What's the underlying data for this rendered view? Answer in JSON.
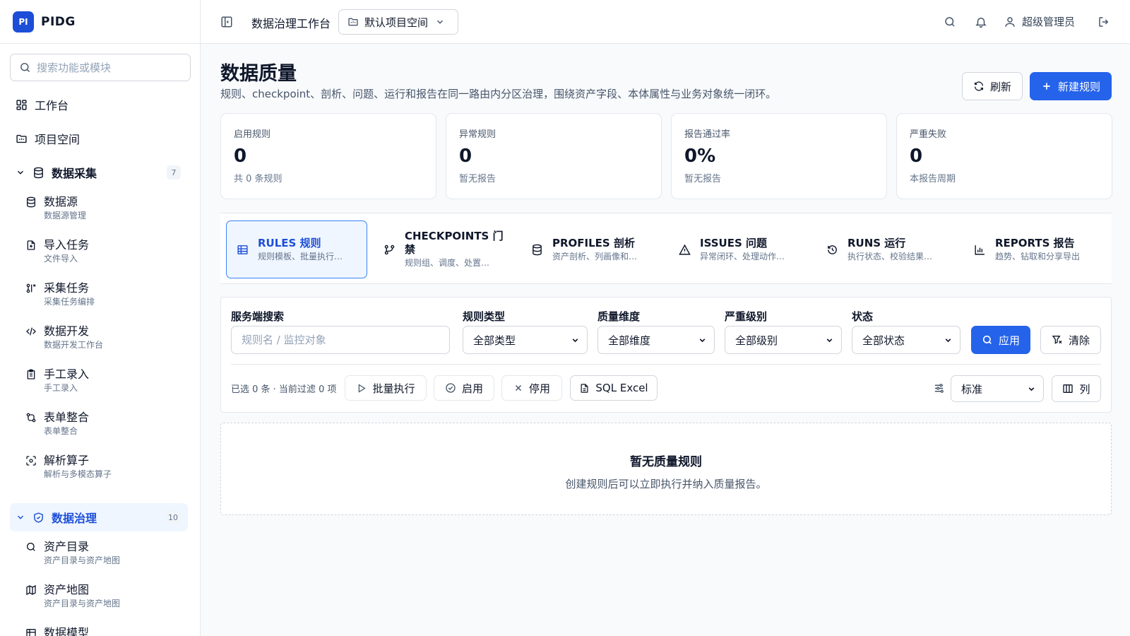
{
  "brand": {
    "logo": "PI",
    "name": "PIDG"
  },
  "sidebar": {
    "search_placeholder": "搜索功能或模块",
    "top_items": [
      {
        "label": "工作台",
        "icon": "dashboard-icon"
      },
      {
        "label": "项目空间",
        "icon": "folder-icon"
      }
    ],
    "group_collect": {
      "label": "数据采集",
      "badge": "7",
      "icon": "database-icon"
    },
    "collect_items": [
      {
        "label": "数据源",
        "sub": "数据源管理",
        "icon": "database-icon"
      },
      {
        "label": "导入任务",
        "sub": "文件导入",
        "icon": "file-import-icon"
      },
      {
        "label": "采集任务",
        "sub": "采集任务编排",
        "icon": "workflow-icon"
      },
      {
        "label": "数据开发",
        "sub": "数据开发工作台",
        "icon": "code-icon"
      },
      {
        "label": "手工录入",
        "sub": "手工录入",
        "icon": "clipboard-icon"
      },
      {
        "label": "表单整合",
        "sub": "表单整合",
        "icon": "merge-icon"
      },
      {
        "label": "解析算子",
        "sub": "解析与多模态算子",
        "icon": "scan-icon"
      }
    ],
    "group_govern": {
      "label": "数据治理",
      "badge": "10",
      "icon": "shield-icon"
    },
    "govern_items": [
      {
        "label": "资产目录",
        "sub": "资产目录与资产地图",
        "icon": "search-icon"
      },
      {
        "label": "资产地图",
        "sub": "资产目录与资产地图",
        "icon": "map-icon"
      },
      {
        "label": "数据模型",
        "sub": "",
        "icon": "table-icon"
      }
    ]
  },
  "header": {
    "title": "数据治理工作台",
    "project": "默认项目空间",
    "user": "超级管理员"
  },
  "page": {
    "title": "数据质量",
    "description": "规则、checkpoint、剖析、问题、运行和报告在同一路由内分区治理，围绕资产字段、本体属性与业务对象统一闭环。",
    "refresh_label": "刷新",
    "new_rule_label": "新建规则"
  },
  "stats": [
    {
      "label": "启用规则",
      "value": "0",
      "sub": "共 0 条规则"
    },
    {
      "label": "异常规则",
      "value": "0",
      "sub": "暂无报告"
    },
    {
      "label": "报告通过率",
      "value": "0%",
      "sub": "暂无报告"
    },
    {
      "label": "严重失败",
      "value": "0",
      "sub": "本报告周期"
    }
  ],
  "tabs": [
    {
      "title": "RULES 规则",
      "sub": "规则模板、批量执行…",
      "icon": "table-icon"
    },
    {
      "title": "CHECKPOINTS 门禁",
      "sub": "规则组、调度、处置…",
      "icon": "git-branch-icon"
    },
    {
      "title": "PROFILES 剖析",
      "sub": "资产剖析、列画像和…",
      "icon": "database-icon"
    },
    {
      "title": "ISSUES 问题",
      "sub": "异常闭环、处理动作…",
      "icon": "warning-icon"
    },
    {
      "title": "RUNS 运行",
      "sub": "执行状态、校验结果…",
      "icon": "history-icon"
    },
    {
      "title": "REPORTS 报告",
      "sub": "趋势、钻取和分享导出",
      "icon": "bar-chart-icon"
    }
  ],
  "filters": {
    "search_label": "服务端搜索",
    "search_placeholder": "规则名 / 监控对象",
    "type_label": "规则类型",
    "type_value": "全部类型",
    "dimension_label": "质量维度",
    "dimension_value": "全部维度",
    "severity_label": "严重级别",
    "severity_value": "全部级别",
    "status_label": "状态",
    "status_value": "全部状态",
    "apply_label": "应用",
    "clear_label": "清除"
  },
  "bulk": {
    "info": "已选 0 条 · 当前过滤 0 项",
    "run_label": "批量执行",
    "enable_label": "启用",
    "disable_label": "停用",
    "sql_label": "SQL Excel",
    "density_value": "标准",
    "columns_label": "列"
  },
  "empty": {
    "title": "暂无质量规则",
    "subtitle": "创建规则后可以立即执行并纳入质量报告。"
  },
  "colors": {
    "primary": "#2563eb",
    "active_bg": "#eff6ff",
    "border": "#e5e7eb"
  }
}
